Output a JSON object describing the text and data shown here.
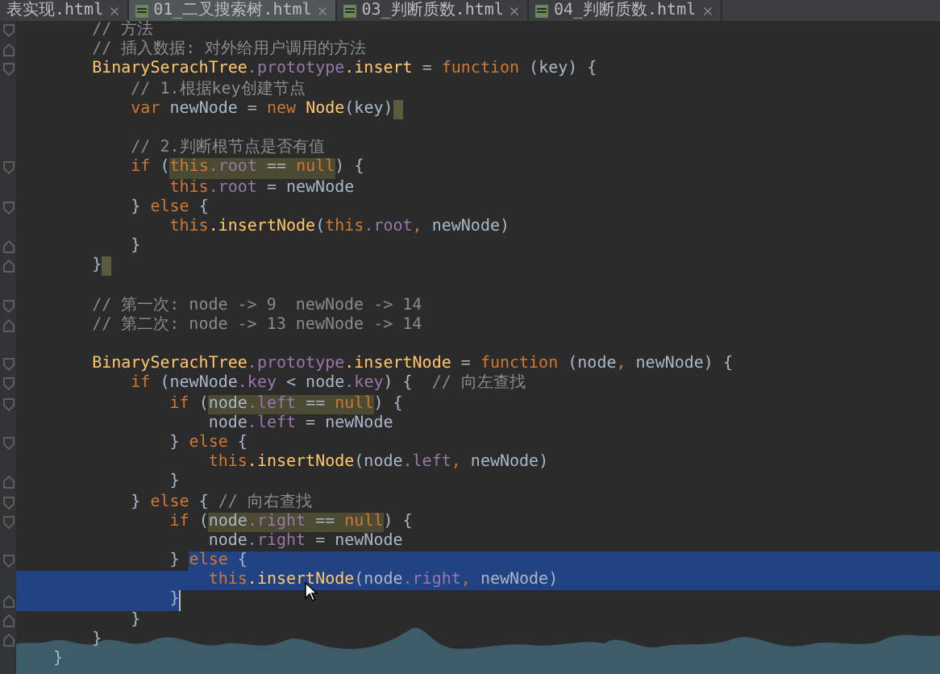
{
  "tabs": [
    {
      "label": "表实现.html",
      "selected": false,
      "icon": false
    },
    {
      "label": "01_二叉搜索树.html",
      "selected": true,
      "icon": true
    },
    {
      "label": "03_判断质数.html",
      "selected": false,
      "icon": true
    },
    {
      "label": "04_判断质数.html",
      "selected": false,
      "icon": true
    }
  ],
  "lines": [
    {
      "kind": "code",
      "fold_start": true,
      "groups": [
        {
          "kind": "code",
          "tokens": [
            {
              "text": "    // 方法",
              "kind": "comment"
            }
          ]
        }
      ]
    },
    {
      "kind": "code",
      "fold_end": true,
      "groups": [
        {
          "kind": "code",
          "tokens": [
            {
              "text": "    // 插入数据: 对外给用户调用的方法",
              "kind": "comment"
            }
          ]
        }
      ]
    },
    {
      "kind": "code",
      "fold_start": true,
      "groups": [
        {
          "kind": "code",
          "tokens": [
            {
              "text": "    BinarySerachTree",
              "kind": "func"
            },
            {
              "text": ".prototype",
              "kind": "field"
            },
            {
              "text": ".insert",
              "kind": "func"
            },
            {
              "text": " = ",
              "kind": "plain"
            },
            {
              "text": "function",
              "kind": "keyword"
            },
            {
              "text": " (key) {",
              "kind": "plain"
            }
          ]
        }
      ]
    },
    {
      "kind": "code",
      "groups": [
        {
          "kind": "code",
          "tokens": [
            {
              "text": "        // 1.根据key创建节点",
              "kind": "comment"
            }
          ]
        }
      ]
    },
    {
      "kind": "code",
      "groups": [
        {
          "kind": "code",
          "tokens": [
            {
              "text": "        var",
              "kind": "keyword"
            },
            {
              "text": " newNode = ",
              "kind": "plain"
            },
            {
              "text": "new ",
              "kind": "keyword"
            },
            {
              "text": "Node",
              "kind": "func"
            },
            {
              "text": "(key)",
              "kind": "plain"
            }
          ]
        },
        {
          "kind": "brace_marker"
        }
      ]
    },
    {
      "kind": "blank"
    },
    {
      "kind": "code",
      "groups": [
        {
          "kind": "code",
          "tokens": [
            {
              "text": "        // 2.判断根节点是否有值",
              "kind": "comment"
            }
          ]
        }
      ]
    },
    {
      "kind": "code",
      "fold_start": true,
      "groups": [
        {
          "kind": "code",
          "tokens": [
            {
              "text": "        if",
              "kind": "keyword"
            },
            {
              "text": " (",
              "kind": "plain"
            }
          ]
        },
        {
          "kind": "match",
          "tokens": [
            {
              "text": "this",
              "kind": "keyword"
            },
            {
              "text": ".root",
              "kind": "field"
            },
            {
              "text": " == ",
              "kind": "plain"
            },
            {
              "text": "null",
              "kind": "keyword"
            }
          ]
        },
        {
          "kind": "code",
          "tokens": [
            {
              "text": ") {",
              "kind": "plain"
            }
          ]
        }
      ]
    },
    {
      "kind": "code",
      "groups": [
        {
          "kind": "code",
          "tokens": [
            {
              "text": "            this",
              "kind": "keyword"
            },
            {
              "text": ".root",
              "kind": "field"
            },
            {
              "text": " = newNode",
              "kind": "plain"
            }
          ]
        }
      ]
    },
    {
      "kind": "code",
      "fold_start": true,
      "groups": [
        {
          "kind": "code",
          "tokens": [
            {
              "text": "        } ",
              "kind": "plain"
            },
            {
              "text": "else",
              "kind": "keyword"
            },
            {
              "text": " {",
              "kind": "plain"
            }
          ]
        }
      ]
    },
    {
      "kind": "code",
      "groups": [
        {
          "kind": "code",
          "tokens": [
            {
              "text": "            this",
              "kind": "keyword"
            },
            {
              "text": ".insertNode",
              "kind": "func"
            },
            {
              "text": "(",
              "kind": "plain"
            },
            {
              "text": "this",
              "kind": "keyword"
            },
            {
              "text": ".root",
              "kind": "field"
            },
            {
              "text": ", ",
              "kind": "keyword"
            },
            {
              "text": "newNode)",
              "kind": "plain"
            }
          ]
        }
      ]
    },
    {
      "kind": "code",
      "fold_end": true,
      "groups": [
        {
          "kind": "code",
          "tokens": [
            {
              "text": "        }",
              "kind": "plain"
            }
          ]
        }
      ]
    },
    {
      "kind": "code",
      "fold_end": true,
      "groups": [
        {
          "kind": "code",
          "tokens": [
            {
              "text": "    }",
              "kind": "plain"
            }
          ]
        },
        {
          "kind": "brace_marker"
        }
      ]
    },
    {
      "kind": "blank"
    },
    {
      "kind": "code",
      "fold_start": true,
      "groups": [
        {
          "kind": "code",
          "tokens": [
            {
              "text": "    // 第一次: node -> 9  newNode -> 14",
              "kind": "comment"
            }
          ]
        }
      ]
    },
    {
      "kind": "code",
      "fold_end": true,
      "groups": [
        {
          "kind": "code",
          "tokens": [
            {
              "text": "    // 第二次: node -> 13 newNode -> 14",
              "kind": "comment"
            }
          ]
        }
      ]
    },
    {
      "kind": "blank"
    },
    {
      "kind": "code",
      "fold_start": true,
      "groups": [
        {
          "kind": "code",
          "tokens": [
            {
              "text": "    BinarySerachTree",
              "kind": "func"
            },
            {
              "text": ".prototype",
              "kind": "field"
            },
            {
              "text": ".insertNode",
              "kind": "func"
            },
            {
              "text": " = ",
              "kind": "plain"
            },
            {
              "text": "function",
              "kind": "keyword"
            },
            {
              "text": " (node",
              "kind": "plain"
            },
            {
              "text": ", ",
              "kind": "keyword"
            },
            {
              "text": "newNode) {",
              "kind": "plain"
            }
          ]
        }
      ]
    },
    {
      "kind": "code",
      "fold_start": true,
      "groups": [
        {
          "kind": "code",
          "tokens": [
            {
              "text": "        if",
              "kind": "keyword"
            },
            {
              "text": " (newNode",
              "kind": "plain"
            },
            {
              "text": ".key",
              "kind": "field"
            },
            {
              "text": " < node",
              "kind": "plain"
            },
            {
              "text": ".key",
              "kind": "field"
            },
            {
              "text": ") {  ",
              "kind": "plain"
            },
            {
              "text": "// 向左查找",
              "kind": "comment"
            }
          ]
        }
      ]
    },
    {
      "kind": "code",
      "fold_start": true,
      "groups": [
        {
          "kind": "code",
          "tokens": [
            {
              "text": "            if",
              "kind": "keyword"
            },
            {
              "text": " (",
              "kind": "plain"
            }
          ]
        },
        {
          "kind": "match",
          "tokens": [
            {
              "text": "node",
              "kind": "plain"
            },
            {
              "text": ".left",
              "kind": "field"
            },
            {
              "text": " == ",
              "kind": "plain"
            },
            {
              "text": "null",
              "kind": "keyword"
            }
          ]
        },
        {
          "kind": "code",
          "tokens": [
            {
              "text": ") {",
              "kind": "plain"
            }
          ]
        }
      ]
    },
    {
      "kind": "code",
      "groups": [
        {
          "kind": "code",
          "tokens": [
            {
              "text": "                node",
              "kind": "plain"
            },
            {
              "text": ".left",
              "kind": "field"
            },
            {
              "text": " = newNode",
              "kind": "plain"
            }
          ]
        }
      ]
    },
    {
      "kind": "code",
      "fold_start": true,
      "groups": [
        {
          "kind": "code",
          "tokens": [
            {
              "text": "            } ",
              "kind": "plain"
            },
            {
              "text": "else",
              "kind": "keyword"
            },
            {
              "text": " {",
              "kind": "plain"
            }
          ]
        }
      ]
    },
    {
      "kind": "code",
      "groups": [
        {
          "kind": "code",
          "tokens": [
            {
              "text": "                this",
              "kind": "keyword"
            },
            {
              "text": ".insertNode",
              "kind": "func"
            },
            {
              "text": "(node",
              "kind": "plain"
            },
            {
              "text": ".left",
              "kind": "field"
            },
            {
              "text": ", ",
              "kind": "keyword"
            },
            {
              "text": "newNode)",
              "kind": "plain"
            }
          ]
        }
      ]
    },
    {
      "kind": "code",
      "fold_end": true,
      "groups": [
        {
          "kind": "code",
          "tokens": [
            {
              "text": "            }",
              "kind": "plain"
            }
          ]
        }
      ]
    },
    {
      "kind": "code",
      "fold_start": true,
      "groups": [
        {
          "kind": "code",
          "tokens": [
            {
              "text": "        } ",
              "kind": "plain"
            },
            {
              "text": "else",
              "kind": "keyword"
            },
            {
              "text": " { ",
              "kind": "plain"
            },
            {
              "text": "// 向右查找",
              "kind": "comment"
            }
          ]
        }
      ]
    },
    {
      "kind": "code",
      "fold_start": true,
      "groups": [
        {
          "kind": "code",
          "tokens": [
            {
              "text": "            if",
              "kind": "keyword"
            },
            {
              "text": " (",
              "kind": "plain"
            }
          ]
        },
        {
          "kind": "match",
          "tokens": [
            {
              "text": "node",
              "kind": "plain"
            },
            {
              "text": ".right",
              "kind": "field"
            },
            {
              "text": " == ",
              "kind": "plain"
            },
            {
              "text": "null",
              "kind": "keyword"
            }
          ]
        },
        {
          "kind": "code",
          "tokens": [
            {
              "text": ") {",
              "kind": "plain"
            }
          ]
        }
      ]
    },
    {
      "kind": "code",
      "groups": [
        {
          "kind": "code",
          "tokens": [
            {
              "text": "                node",
              "kind": "plain"
            },
            {
              "text": ".right",
              "kind": "field"
            },
            {
              "text": " = newNode",
              "kind": "plain"
            }
          ]
        }
      ]
    },
    {
      "kind": "code",
      "fold_start": true,
      "groups": [
        {
          "kind": "code",
          "tokens": [
            {
              "text": "            } ",
              "kind": "plain"
            }
          ]
        },
        {
          "kind": "selection",
          "tokens": [
            {
              "text": "else",
              "kind": "keyword"
            },
            {
              "text": " {",
              "kind": "plain"
            }
          ]
        },
        {
          "kind": "selection_pad"
        }
      ]
    },
    {
      "kind": "code",
      "groups": [
        {
          "kind": "selection_pad"
        },
        {
          "kind": "selection",
          "tokens": [
            {
              "text": "                this",
              "kind": "keyword"
            },
            {
              "text": ".insertNode",
              "kind": "func"
            },
            {
              "text": "(node",
              "kind": "plain"
            },
            {
              "text": ".right",
              "kind": "field"
            },
            {
              "text": ", ",
              "kind": "keyword"
            },
            {
              "text": "newNode)",
              "kind": "plain"
            }
          ]
        },
        {
          "kind": "selection_pad"
        }
      ]
    },
    {
      "kind": "code",
      "fold_end": true,
      "groups": [
        {
          "kind": "selection_pad"
        },
        {
          "kind": "selection",
          "tokens": [
            {
              "text": "            }",
              "kind": "plain"
            }
          ]
        },
        {
          "kind": "caret"
        }
      ]
    },
    {
      "kind": "code",
      "fold_end": true,
      "groups": [
        {
          "kind": "code",
          "tokens": [
            {
              "text": "        }",
              "kind": "plain"
            }
          ]
        }
      ]
    },
    {
      "kind": "code",
      "fold_end": true,
      "groups": [
        {
          "kind": "code",
          "tokens": [
            {
              "text": "    }",
              "kind": "plain"
            }
          ]
        }
      ]
    },
    {
      "kind": "code",
      "groups": [
        {
          "kind": "code",
          "tokens": [
            {
              "text": "}",
              "kind": "plain"
            }
          ]
        }
      ]
    }
  ]
}
